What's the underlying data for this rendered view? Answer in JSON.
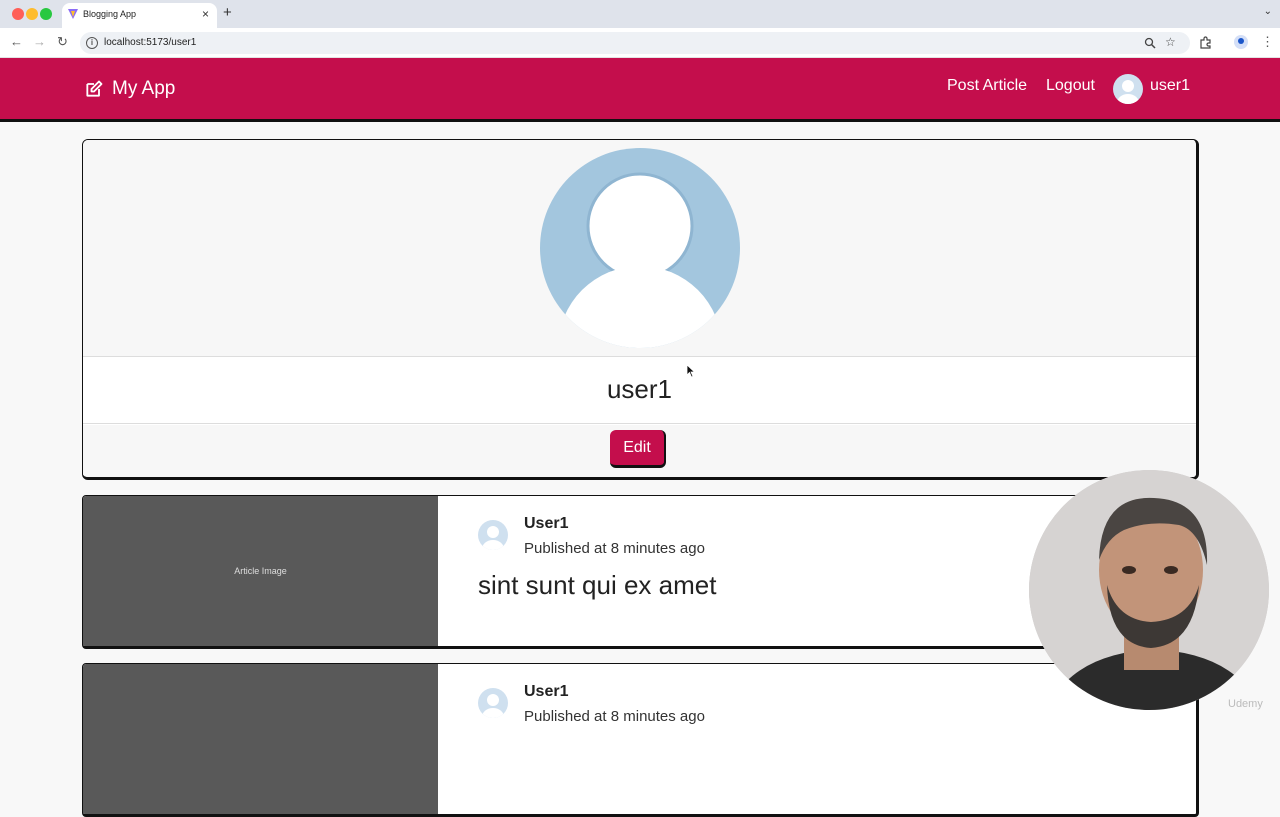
{
  "browser": {
    "tab_title": "Blogging App",
    "url": "localhost:5173/user1"
  },
  "navbar": {
    "brand": "My App",
    "links": [
      "Post Article",
      "Logout"
    ],
    "username": "user1"
  },
  "profile": {
    "name": "user1",
    "edit_label": "Edit"
  },
  "articles": [
    {
      "image_alt": "Article Image",
      "author": "User1",
      "published": "Published at 8 minutes ago",
      "title": "sint sunt qui ex amet"
    },
    {
      "image_alt": "",
      "author": "User1",
      "published": "Published at 8 minutes ago",
      "title": ""
    }
  ],
  "overlay": {
    "watermark": "Udemy"
  },
  "colors": {
    "navbar": "#c40e4c",
    "avatar": "#a3c6de",
    "image_placeholder": "#595959"
  }
}
